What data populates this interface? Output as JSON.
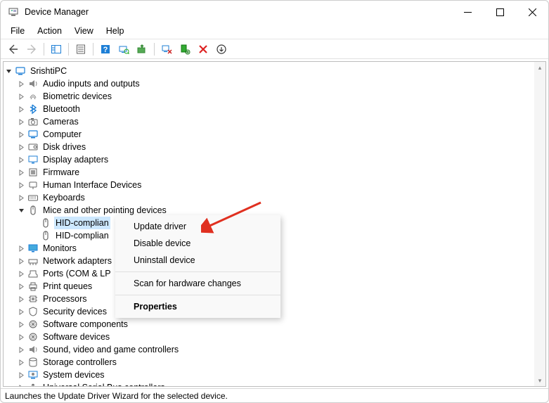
{
  "window": {
    "title": "Device Manager",
    "status": "Launches the Update Driver Wizard for the selected device."
  },
  "menubar": [
    "File",
    "Action",
    "View",
    "Help"
  ],
  "tree": {
    "root": "SrishtiPC",
    "items": [
      {
        "label": "Audio inputs and outputs",
        "icon": "speaker"
      },
      {
        "label": "Biometric devices",
        "icon": "fingerprint"
      },
      {
        "label": "Bluetooth",
        "icon": "bluetooth"
      },
      {
        "label": "Cameras",
        "icon": "camera"
      },
      {
        "label": "Computer",
        "icon": "computer"
      },
      {
        "label": "Disk drives",
        "icon": "disk"
      },
      {
        "label": "Display adapters",
        "icon": "display"
      },
      {
        "label": "Firmware",
        "icon": "firmware"
      },
      {
        "label": "Human Interface Devices",
        "icon": "hid"
      },
      {
        "label": "Keyboards",
        "icon": "keyboard"
      },
      {
        "label": "Mice and other pointing devices",
        "icon": "mouse",
        "expanded": true,
        "children": [
          {
            "label": "HID-complian",
            "icon": "mouse",
            "selected": true
          },
          {
            "label": "HID-complian",
            "icon": "mouse"
          }
        ]
      },
      {
        "label": "Monitors",
        "icon": "monitor"
      },
      {
        "label": "Network adapters",
        "icon": "network"
      },
      {
        "label": "Ports (COM & LP",
        "icon": "port"
      },
      {
        "label": "Print queues",
        "icon": "printer"
      },
      {
        "label": "Processors",
        "icon": "cpu"
      },
      {
        "label": "Security devices",
        "icon": "security"
      },
      {
        "label": "Software components",
        "icon": "software"
      },
      {
        "label": "Software devices",
        "icon": "software"
      },
      {
        "label": "Sound, video and game controllers",
        "icon": "speaker"
      },
      {
        "label": "Storage controllers",
        "icon": "storage"
      },
      {
        "label": "System devices",
        "icon": "system"
      },
      {
        "label": "Universal Serial Bus controllers",
        "icon": "usb"
      }
    ]
  },
  "context_menu": {
    "items": [
      {
        "label": "Update driver"
      },
      {
        "label": "Disable device"
      },
      {
        "label": "Uninstall device"
      },
      {
        "sep": true
      },
      {
        "label": "Scan for hardware changes"
      },
      {
        "sep": true
      },
      {
        "label": "Properties",
        "bold": true
      }
    ]
  }
}
